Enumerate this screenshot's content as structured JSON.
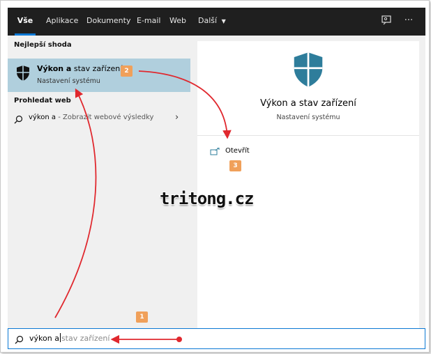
{
  "tabs": [
    {
      "label": "Vše",
      "active": true
    },
    {
      "label": "Aplikace",
      "active": false
    },
    {
      "label": "Dokumenty",
      "active": false
    },
    {
      "label": "E-mail",
      "active": false
    },
    {
      "label": "Web",
      "active": false
    },
    {
      "label": "Další",
      "active": false
    }
  ],
  "toolbar": {
    "feedback_icon": "feedback-icon",
    "more_icon": "more-icon"
  },
  "left": {
    "best_match_label": "Nejlepší shoda",
    "best_match": {
      "title_bold": "Výkon a",
      "title_rest": " stav zařízení",
      "subtitle": "Nastavení systému",
      "icon": "shield-icon"
    },
    "web_label": "Prohledat web",
    "web_result": {
      "query": "výkon a",
      "suffix": " - Zobrazit webové výsledky"
    }
  },
  "right": {
    "title": "Výkon a stav zařízení",
    "subtitle": "Nastavení systému",
    "open_label": "Otevřít"
  },
  "search": {
    "typed": "výkon a",
    "completion": "stav zařízení"
  },
  "badges": {
    "b1": "1",
    "b2": "2",
    "b3": "3"
  },
  "watermark": "tritong.cz",
  "colors": {
    "accent": "#0a78d4",
    "selection": "#b0cfdd",
    "shield": "#2e7d9b",
    "arrow": "#e0282e",
    "badge": "#f0a05a"
  }
}
